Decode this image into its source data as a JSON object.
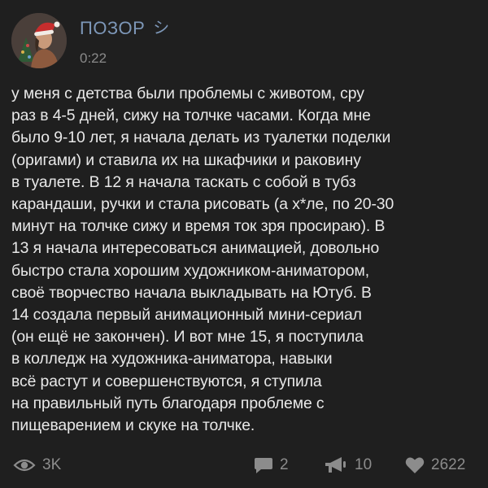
{
  "author": {
    "name": "ПОЗОР",
    "name_symbol": "シ",
    "time": "0:22"
  },
  "post": {
    "text": "у меня с детства были проблемы с животом, сру\nраз в 4-5 дней, сижу на толчке часами. Когда мне\nбыло 9-10 лет, я начала делать из туалетки поделки\n(оригами) и ставила их на шкафчики и раковину\nв туалете. В 12 я начала таскать с собой в тубз\nкарандаши, ручки и стала рисовать (а х*ле, по 20-30\nминут на толчке сижу и время ток зря просираю). В\n13 я начала интересоваться анимацией, довольно\nбыстро стала хорошим художником-аниматором,\nсвоё творчество начала выкладывать на Ютуб. В\n14 создала первый анимационный мини-сериал\n(он ещё не закончен). И вот мне 15, я поступила\nв колледж на художника-аниматора, навыки\nвсё растут и совершенствуются, я ступила\nна правильный путь благодаря проблеме с\nпищеварением и скуке на толчке."
  },
  "stats": {
    "views": "3K",
    "comments": "2",
    "reposts": "10",
    "likes": "2622"
  },
  "colors": {
    "background": "#1f1f1f",
    "author_name": "#7d97b8",
    "text": "#e8e8e8",
    "muted": "#8c8c8c"
  },
  "icons": {
    "views": "eye-icon",
    "comments": "comment-icon",
    "reposts": "megaphone-icon",
    "likes": "heart-icon"
  }
}
